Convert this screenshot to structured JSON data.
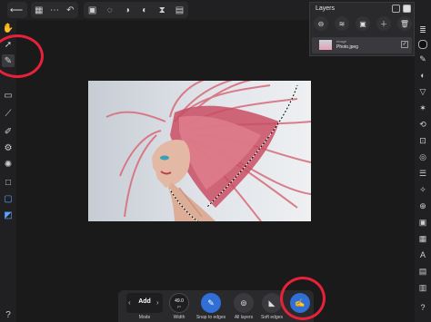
{
  "layers_panel": {
    "title": "Layers",
    "layer": {
      "type": "Image",
      "name": "Photo.jpeg"
    }
  },
  "context_toolbar": {
    "mode_value": "Add",
    "mode_label": "Mode",
    "width_value": "49.0",
    "width_unit": "px",
    "width_label": "Width",
    "snap_label": "Snap to edges",
    "all_layers_label": "All layers",
    "soft_edges_label": "Soft edges"
  },
  "colors": {
    "annotation": "#e8213a",
    "accent": "#2f6fd6"
  }
}
